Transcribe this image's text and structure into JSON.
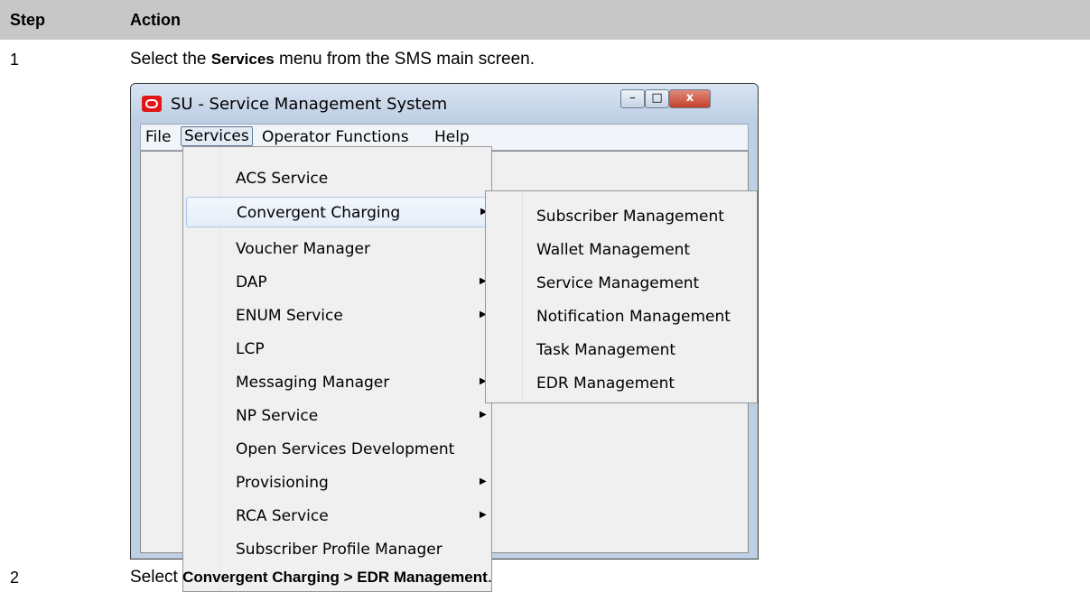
{
  "table": {
    "header": {
      "step": "Step",
      "action": "Action"
    },
    "steps": [
      {
        "number": "1",
        "pre": "Select the ",
        "bold": "Services",
        "post": " menu from the SMS main screen."
      },
      {
        "number": "2",
        "pre": "Select ",
        "bold": "Convergent Charging > EDR Management",
        "post": "."
      }
    ]
  },
  "window": {
    "title": "SU - Service Management System",
    "caption_buttons": {
      "minimize": "–",
      "maximize": "□",
      "close": "x"
    },
    "menubar": [
      "File",
      "Services",
      "Operator Functions",
      "Help"
    ],
    "services_menu": [
      {
        "label": "ACS Service",
        "submenu": false
      },
      {
        "label": "Convergent Charging",
        "submenu": true,
        "highlighted": true
      },
      {
        "label": "Voucher Manager",
        "submenu": false
      },
      {
        "label": "DAP",
        "submenu": true
      },
      {
        "label": "ENUM Service",
        "submenu": true
      },
      {
        "label": "LCP",
        "submenu": false
      },
      {
        "label": "Messaging Manager",
        "submenu": true
      },
      {
        "label": "NP Service",
        "submenu": true
      },
      {
        "label": "Open Services Development",
        "submenu": false
      },
      {
        "label": "Provisioning",
        "submenu": true
      },
      {
        "label": "RCA Service",
        "submenu": true
      },
      {
        "label": "Subscriber Profile Manager",
        "submenu": false
      }
    ],
    "convergent_charging_submenu": [
      "Subscriber Management",
      "Wallet Management",
      "Service Management",
      "Notification Management",
      "Task Management",
      "EDR Management"
    ],
    "submenu_arrow": "▶"
  }
}
